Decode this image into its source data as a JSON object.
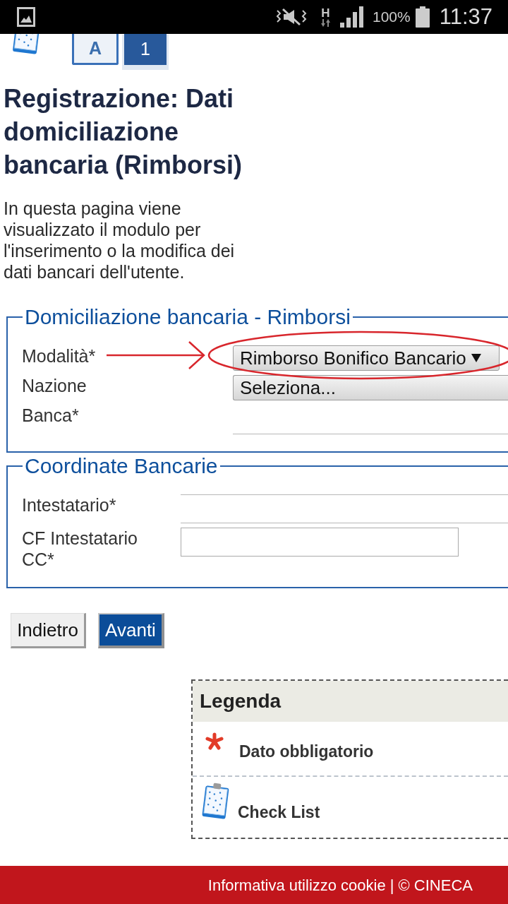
{
  "status_bar": {
    "network": "H",
    "battery": "100%",
    "time": "11:37"
  },
  "steps": [
    {
      "label": "A",
      "selected": false
    },
    {
      "label": "1",
      "selected": true
    }
  ],
  "page": {
    "title": "Registrazione: Dati domiciliazione bancaria (Rimborsi)",
    "description": "In questa pagina viene visualizzato il modulo per l'inserimento o la modifica dei dati bancari dell'utente."
  },
  "sections": [
    {
      "legend": "Domiciliazione bancaria - Rimborsi",
      "fields": [
        {
          "label": "Modalità*",
          "kind": "select",
          "value": "Rimborso Bonifico Bancario"
        },
        {
          "label": "Nazione",
          "kind": "select",
          "value": "Seleziona..."
        },
        {
          "label": "Banca*",
          "kind": "underline"
        }
      ]
    },
    {
      "legend": "Coordinate Bancarie",
      "fields": [
        {
          "label": "Intestatario*",
          "kind": "lined"
        },
        {
          "label": "CF Intestatario CC*",
          "kind": "boxed"
        }
      ]
    }
  ],
  "buttons": [
    {
      "label": "Indietro",
      "kind": "secondary"
    },
    {
      "label": "Avanti",
      "kind": "primary"
    }
  ],
  "legend_box": {
    "title": "Legenda",
    "items": [
      {
        "kind": "required",
        "label": "Dato obbligatorio"
      },
      {
        "kind": "checklist",
        "label": "Check List"
      }
    ]
  },
  "footer": {
    "link": "Informativa utilizzo cookie",
    "copyright": "| © CINECA"
  }
}
